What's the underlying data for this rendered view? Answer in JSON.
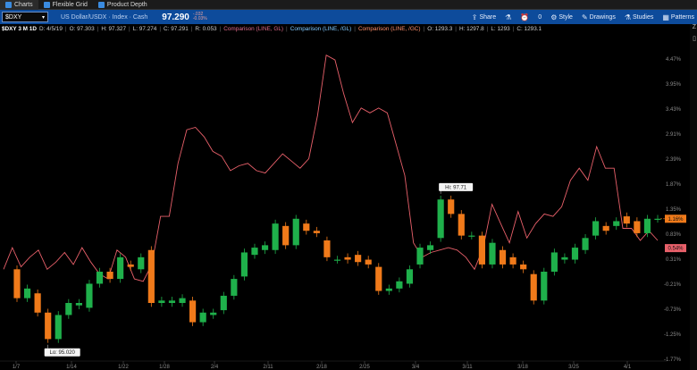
{
  "tabs": [
    {
      "label": "Charts",
      "icon": "chart-icon",
      "active": true
    },
    {
      "label": "Flexible Grid",
      "icon": "grid-icon",
      "active": false
    },
    {
      "label": "Product Depth",
      "icon": "depth-icon",
      "active": false
    }
  ],
  "toolbar": {
    "symbol": "$DXY",
    "description": "US Dollar/USDX · Index · Cash",
    "last_price": "97.290",
    "change_abs": "-.032",
    "change_pct": "-0.03%",
    "buttons": {
      "share": "Share",
      "alert_value": "0",
      "style": "Style",
      "drawings": "Drawings",
      "studies": "Studies",
      "patterns": "Patterns"
    }
  },
  "info": {
    "main": "$DXY 3 M 1D",
    "date": "D: 4/5/19",
    "open": "O: 97.303",
    "high": "H: 97.327",
    "low": "L: 97.274",
    "close": "C: 97.291",
    "range": "R: 0.053",
    "comp1": "Comparison (LINE, GL)",
    "comp2": "Comparison (LINE, /GL)",
    "comp3": "Comparison (LINE, /GC)",
    "comp3_open": "O: 1293.3",
    "comp3_high": "H: 1297.8",
    "comp3_low": "L: 1293",
    "comp3_close": "C: 1293.1"
  },
  "colors": {
    "up": "#1fb04b",
    "down": "#f07a1a",
    "comparison": "#e8606a",
    "toolbar": "#0d4b9b",
    "axis_text": "#8a8a8a"
  },
  "chart_data": {
    "type": "candlestick",
    "x_ticks": [
      "1/7",
      "1/14",
      "1/22",
      "1/28",
      "2/4",
      "2/11",
      "2/18",
      "2/25",
      "3/4",
      "3/11",
      "3/18",
      "3/25",
      "4/1"
    ],
    "y_ticks": [
      "4.47%",
      "3.95%",
      "3.43%",
      "2.91%",
      "2.39%",
      "1.87%",
      "1.35%",
      "0.83%",
      "0.31%",
      "-0.21%",
      "-0.73%",
      "-1.25%",
      "-1.77%"
    ],
    "ylim": [
      -1.77,
      4.99
    ],
    "candles": [
      {
        "o": 0.1,
        "c": -0.5
      },
      {
        "o": -0.5,
        "c": -0.3
      },
      {
        "o": -0.4,
        "c": -0.8
      },
      {
        "o": -0.8,
        "c": -1.35
      },
      {
        "o": -1.35,
        "c": -0.85
      },
      {
        "o": -0.85,
        "c": -0.6
      },
      {
        "o": -0.65,
        "c": -0.6
      },
      {
        "o": -0.7,
        "c": -0.2
      },
      {
        "o": -0.2,
        "c": 0.05
      },
      {
        "o": 0.05,
        "c": -0.1
      },
      {
        "o": -0.1,
        "c": 0.35
      },
      {
        "o": 0.2,
        "c": 0.15
      },
      {
        "o": 0.1,
        "c": 0.35
      },
      {
        "o": 0.5,
        "c": -0.6
      },
      {
        "o": -0.6,
        "c": -0.55
      },
      {
        "o": -0.6,
        "c": -0.55
      },
      {
        "o": -0.6,
        "c": -0.5
      },
      {
        "o": -0.55,
        "c": -1.0
      },
      {
        "o": -1.0,
        "c": -0.8
      },
      {
        "o": -0.85,
        "c": -0.8
      },
      {
        "o": -0.75,
        "c": -0.45
      },
      {
        "o": -0.45,
        "c": -0.1
      },
      {
        "o": -0.05,
        "c": 0.45
      },
      {
        "o": 0.4,
        "c": 0.55
      },
      {
        "o": 0.5,
        "c": 0.6
      },
      {
        "o": 0.5,
        "c": 1.05
      },
      {
        "o": 1.0,
        "c": 0.6
      },
      {
        "o": 0.6,
        "c": 1.15
      },
      {
        "o": 1.05,
        "c": 0.9
      },
      {
        "o": 0.9,
        "c": 0.85
      },
      {
        "o": 0.7,
        "c": 0.35
      },
      {
        "o": 0.3,
        "c": 0.3
      },
      {
        "o": 0.35,
        "c": 0.3
      },
      {
        "o": 0.4,
        "c": 0.25
      },
      {
        "o": 0.3,
        "c": 0.2
      },
      {
        "o": 0.15,
        "c": -0.35
      },
      {
        "o": -0.35,
        "c": -0.3
      },
      {
        "o": -0.3,
        "c": -0.15
      },
      {
        "o": -0.2,
        "c": 0.1
      },
      {
        "o": 0.2,
        "c": 0.55
      },
      {
        "o": 0.5,
        "c": 0.6
      },
      {
        "o": 0.75,
        "c": 1.55
      },
      {
        "o": 1.55,
        "c": 1.25
      },
      {
        "o": 1.25,
        "c": 0.8
      },
      {
        "o": 0.8,
        "c": 0.8
      },
      {
        "o": 0.8,
        "c": 0.2
      },
      {
        "o": 0.2,
        "c": 0.65
      },
      {
        "o": 0.5,
        "c": 0.2
      },
      {
        "o": 0.35,
        "c": 0.2
      },
      {
        "o": 0.2,
        "c": 0.1
      },
      {
        "o": 0.0,
        "c": -0.55
      },
      {
        "o": -0.55,
        "c": 0.05
      },
      {
        "o": 0.05,
        "c": 0.45
      },
      {
        "o": 0.3,
        "c": 0.35
      },
      {
        "o": 0.3,
        "c": 0.55
      },
      {
        "o": 0.5,
        "c": 0.75
      },
      {
        "o": 0.8,
        "c": 1.1
      },
      {
        "o": 1.0,
        "c": 0.9
      },
      {
        "o": 1.0,
        "c": 1.1
      },
      {
        "o": 1.2,
        "c": 1.05
      },
      {
        "o": 1.1,
        "c": 0.85
      },
      {
        "o": 0.85,
        "c": 1.15
      },
      {
        "o": 1.15,
        "c": 1.15
      }
    ],
    "comparison_line": [
      0.1,
      0.55,
      0.15,
      0.35,
      0.5,
      0.1,
      0.25,
      0.45,
      0.2,
      0.55,
      0.25,
      0.0,
      -0.1,
      0.5,
      0.35,
      -0.1,
      -0.15,
      0.2,
      1.2,
      1.2,
      2.3,
      3.0,
      3.05,
      2.85,
      2.55,
      2.45,
      2.15,
      2.25,
      2.3,
      2.15,
      2.1,
      2.3,
      2.5,
      2.35,
      2.2,
      2.4,
      3.3,
      4.55,
      4.45,
      3.75,
      3.15,
      3.45,
      3.35,
      3.45,
      3.35,
      2.7,
      2.05,
      0.65,
      0.35,
      0.45,
      0.5,
      0.55,
      0.5,
      0.35,
      0.1,
      0.55,
      1.45,
      1.05,
      0.65,
      1.3,
      0.75,
      1.05,
      1.25,
      1.2,
      1.4,
      1.95,
      2.2,
      1.95,
      2.65,
      2.2,
      2.2,
      0.95,
      0.95,
      0.7,
      0.9,
      0.7
    ],
    "high_label": "Hi: 97.71",
    "low_label": "Lo: 95.020",
    "price_tag": "1.16%",
    "comp_tag": "0.54%"
  }
}
